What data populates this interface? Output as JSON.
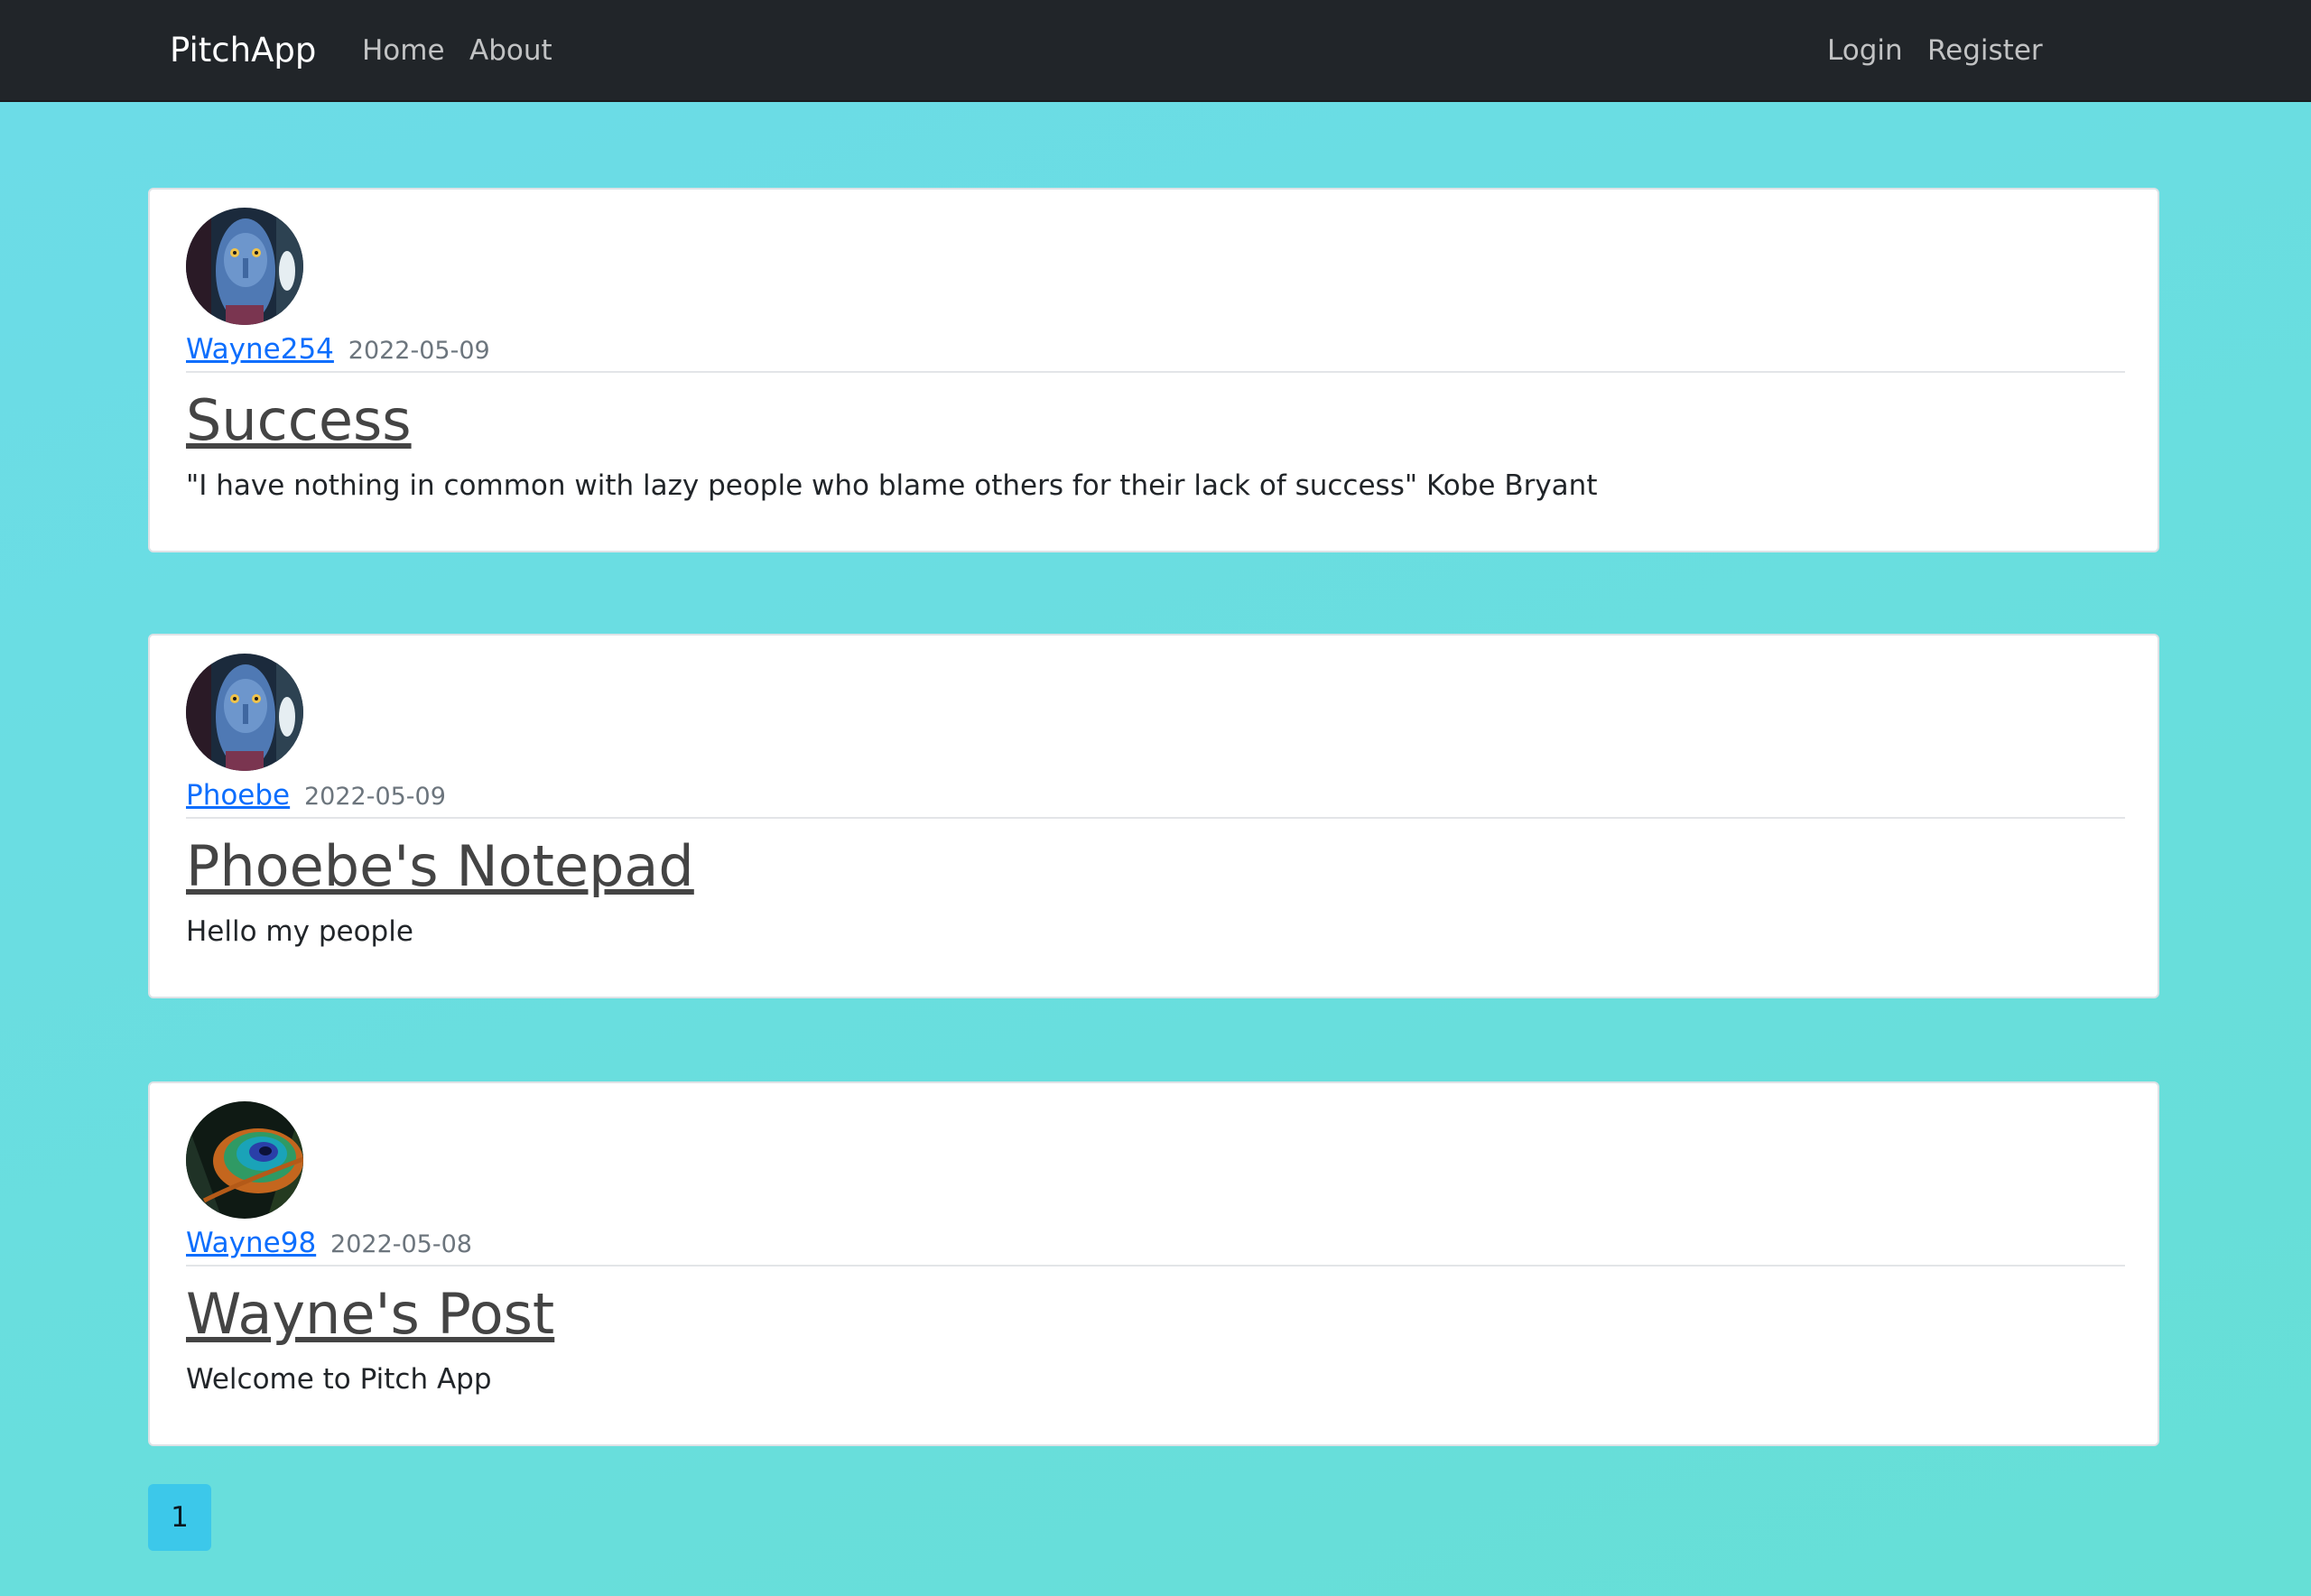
{
  "navbar": {
    "brand": "PitchApp",
    "links": {
      "home": "Home",
      "about": "About",
      "login": "Login",
      "register": "Register"
    }
  },
  "posts": [
    {
      "author": "Wayne254",
      "date": "2022-05-09",
      "title": "Success",
      "body": "\"I have nothing in common with lazy people who blame others for their lack of success\" Kobe Bryant",
      "avatar_icon": "avatar-navi-portrait"
    },
    {
      "author": "Phoebe",
      "date": "2022-05-09",
      "title": "Phoebe's Notepad",
      "body": "Hello my people",
      "avatar_icon": "avatar-navi-portrait"
    },
    {
      "author": "Wayne98",
      "date": "2022-05-08",
      "title": "Wayne's Post",
      "body": "Welcome to Pitch App",
      "avatar_icon": "avatar-peacock-feather"
    }
  ],
  "pagination": {
    "current_page": "1"
  },
  "colors": {
    "navbar_bg": "#212529",
    "page_bg_start": "#6cdce8",
    "page_bg_end": "#66dfd6",
    "link": "#0d6efd",
    "pagination_active": "#3cc8ea"
  }
}
